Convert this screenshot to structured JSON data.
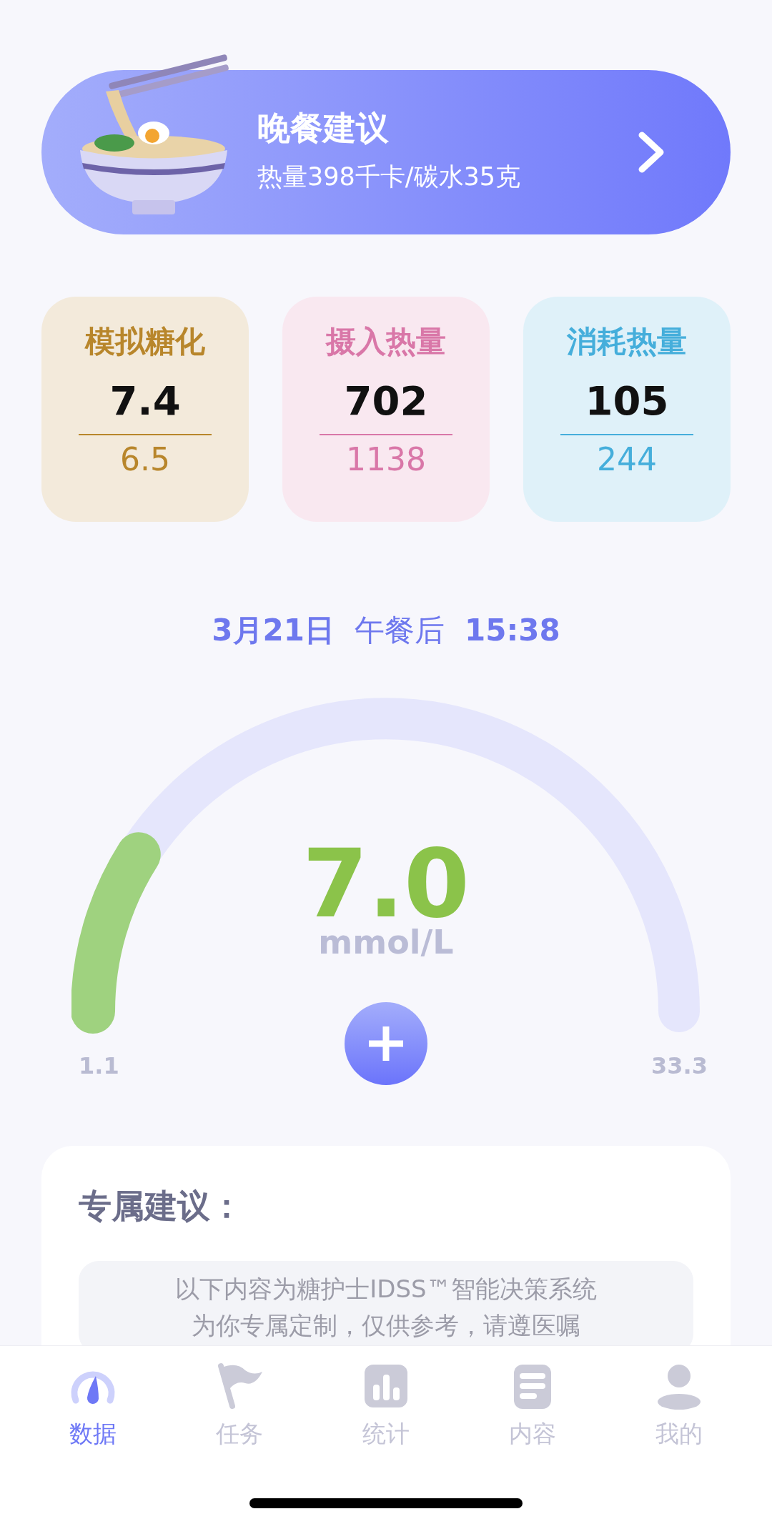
{
  "banner": {
    "title": "晚餐建议",
    "subtitle": "热量398千卡/碳水35克"
  },
  "stats": [
    {
      "title": "模拟糖化",
      "value": "7.4",
      "reference": "6.5",
      "color": "#b8862b"
    },
    {
      "title": "摄入热量",
      "value": "702",
      "reference": "1138",
      "color": "#d977a8"
    },
    {
      "title": "消耗热量",
      "value": "105",
      "reference": "244",
      "color": "#45aedb"
    }
  ],
  "reading": {
    "date": "3月21日",
    "meal": "午餐后",
    "time": "15:38",
    "value": "7.0",
    "unit": "mmol/L",
    "min": "1.1",
    "max": "33.3"
  },
  "advice": {
    "title": "专属建议：",
    "notice": [
      "以下内容为糖护士IDSS™智能决策系统",
      "为你专属定制，仅供参考，请遵医嘱"
    ]
  },
  "tabs": [
    {
      "label": "数据",
      "selected": true
    },
    {
      "label": "任务",
      "selected": false
    },
    {
      "label": "统计",
      "selected": false
    },
    {
      "label": "内容",
      "selected": false
    },
    {
      "label": "我的",
      "selected": false
    }
  ]
}
